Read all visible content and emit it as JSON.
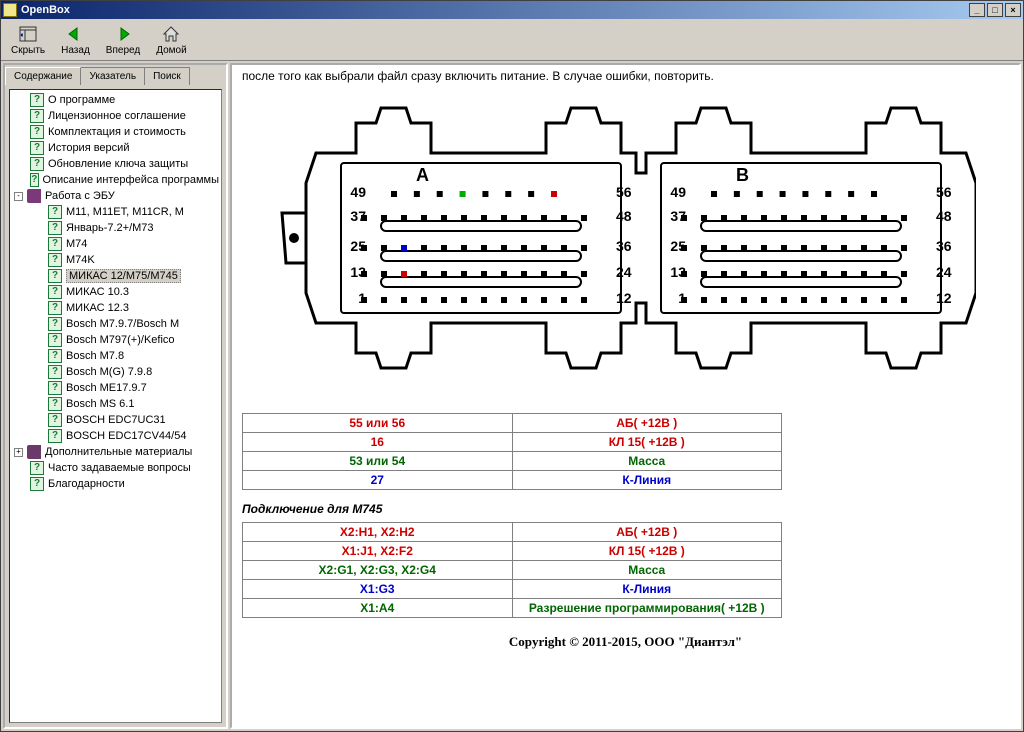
{
  "window": {
    "title": "OpenBox"
  },
  "toolbar": {
    "hide": "Скрыть",
    "back": "Назад",
    "forward": "Вперед",
    "home": "Домой"
  },
  "tabs": {
    "contents": "Содержание",
    "index": "Указатель",
    "search": "Поиск"
  },
  "tree": {
    "items": [
      {
        "level": 1,
        "icon": "q",
        "label": "О программе"
      },
      {
        "level": 1,
        "icon": "q",
        "label": "Лицензионное соглашение"
      },
      {
        "level": 1,
        "icon": "q",
        "label": "Комплектация и стоимость"
      },
      {
        "level": 1,
        "icon": "q",
        "label": "История версий"
      },
      {
        "level": 1,
        "icon": "q",
        "label": "Обновление ключа защиты"
      },
      {
        "level": 1,
        "icon": "q",
        "label": "Описание интерфейса программы"
      },
      {
        "level": 0,
        "icon": "book",
        "toggle": "-",
        "label": "Работа с ЭБУ"
      },
      {
        "level": 2,
        "icon": "q",
        "label": "М11, М11ЕТ, М11CR, М"
      },
      {
        "level": 2,
        "icon": "q",
        "label": "Январь-7.2+/М73"
      },
      {
        "level": 2,
        "icon": "q",
        "label": "М74"
      },
      {
        "level": 2,
        "icon": "q",
        "label": "М74K"
      },
      {
        "level": 2,
        "icon": "q",
        "label": "МИКАС 12/М75/М745",
        "selected": true
      },
      {
        "level": 2,
        "icon": "q",
        "label": "МИКАС 10.3"
      },
      {
        "level": 2,
        "icon": "q",
        "label": "МИКАС 12.3"
      },
      {
        "level": 2,
        "icon": "q",
        "label": "Bosch M7.9.7/Bosch M"
      },
      {
        "level": 2,
        "icon": "q",
        "label": "Bosch М797(+)/Kefico"
      },
      {
        "level": 2,
        "icon": "q",
        "label": "Bosch M7.8"
      },
      {
        "level": 2,
        "icon": "q",
        "label": "Bosch M(G) 7.9.8"
      },
      {
        "level": 2,
        "icon": "q",
        "label": "Bosch ME17.9.7"
      },
      {
        "level": 2,
        "icon": "q",
        "label": "Bosch MS 6.1"
      },
      {
        "level": 2,
        "icon": "q",
        "label": "BOSCH EDC7UC31"
      },
      {
        "level": 2,
        "icon": "q",
        "label": "BOSCH EDC17CV44/54"
      },
      {
        "level": 0,
        "icon": "closedbook",
        "toggle": "+",
        "label": "Дополнительные материалы"
      },
      {
        "level": 1,
        "icon": "q",
        "label": "Часто задаваемые вопросы"
      },
      {
        "level": 1,
        "icon": "q",
        "label": "Благодарности"
      }
    ]
  },
  "content": {
    "top_text": "после того как выбрали файл сразу включить питание. В случае ошибки, повторить.",
    "connector": {
      "labels": {
        "a": "A",
        "b": "B"
      },
      "row_numbers": [
        {
          "left": "49",
          "right": "56"
        },
        {
          "left": "37",
          "right": "48"
        },
        {
          "left": "25",
          "right": "36"
        },
        {
          "left": "13",
          "right": "24"
        },
        {
          "left": "1",
          "right": "12"
        }
      ]
    },
    "table1": [
      {
        "pin": "55 или 56",
        "signal": "АБ( +12В )",
        "cls": "red"
      },
      {
        "pin": "16",
        "signal": "КЛ 15( +12В )",
        "cls": "red"
      },
      {
        "pin": "53 или 54",
        "signal": "Масса",
        "cls": "green"
      },
      {
        "pin": "27",
        "signal": "К-Линия",
        "cls": "blue"
      }
    ],
    "subheading": "Подключение для М745",
    "table2": [
      {
        "pin": "X2:H1, X2:H2",
        "signal": "АБ( +12В )",
        "cls": "red"
      },
      {
        "pin": "X1:J1, X2:F2",
        "signal": "КЛ 15( +12В )",
        "cls": "red"
      },
      {
        "pin": "X2:G1, X2:G3, X2:G4",
        "signal": "Масса",
        "cls": "green"
      },
      {
        "pin": "X1:G3",
        "signal": "К-Линия",
        "cls": "blue"
      },
      {
        "pin": "X1:A4",
        "signal": "Разрешение программирования( +12В )",
        "cls": "green"
      }
    ],
    "copyright": "Copyright © 2011-2015, ООО \"Диантэл\""
  }
}
